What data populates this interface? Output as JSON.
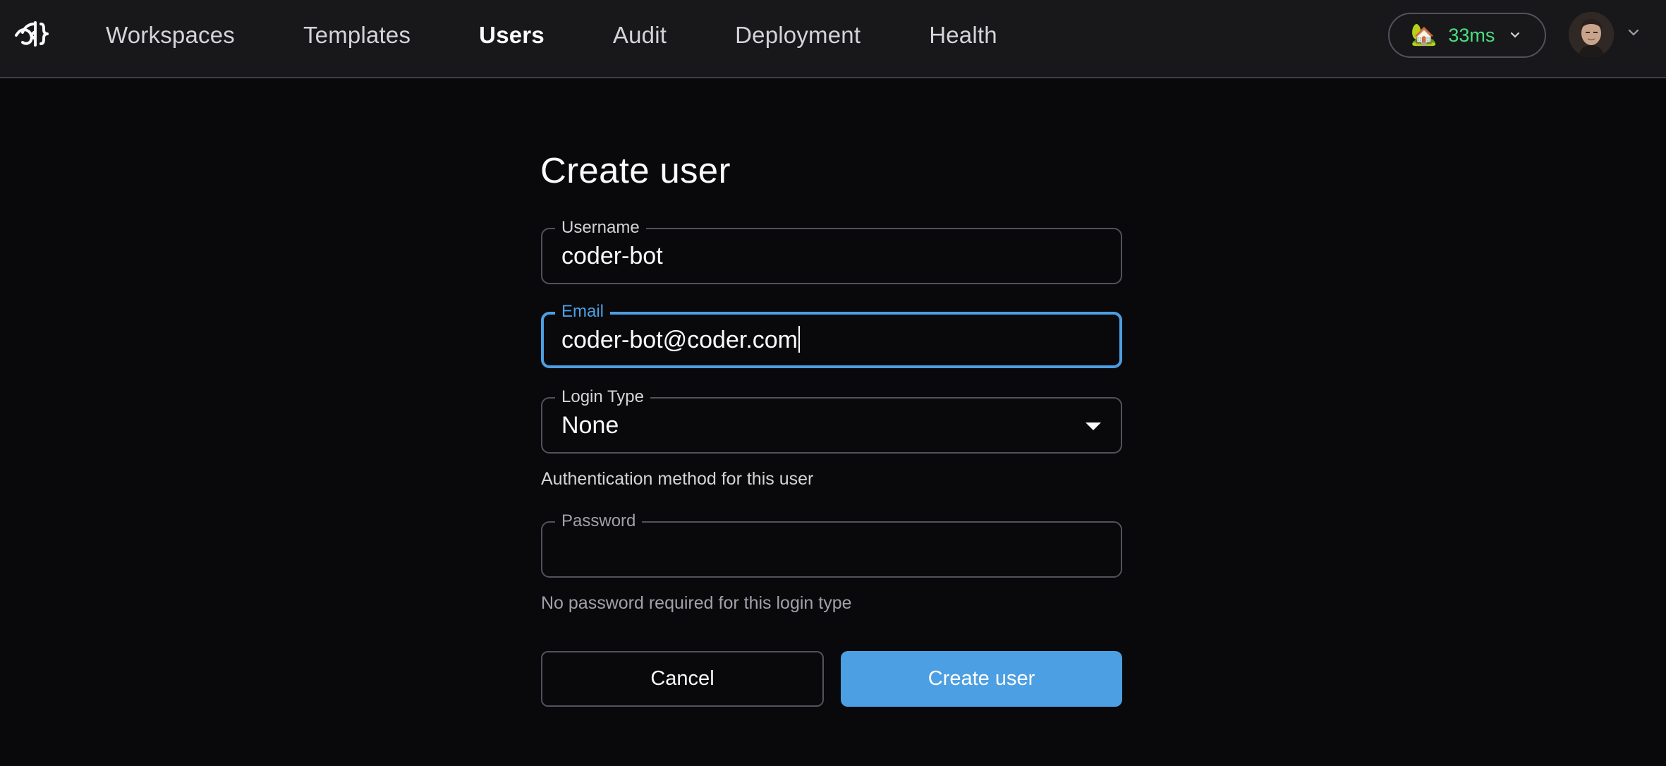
{
  "nav": {
    "items": [
      {
        "label": "Workspaces",
        "active": false
      },
      {
        "label": "Templates",
        "active": false
      },
      {
        "label": "Users",
        "active": true
      },
      {
        "label": "Audit",
        "active": false
      },
      {
        "label": "Deployment",
        "active": false
      },
      {
        "label": "Health",
        "active": false
      }
    ],
    "latency": {
      "icon": "🏡",
      "value": "33ms"
    },
    "colors": {
      "latency_ok": "#4ade80",
      "accent": "#4c9fe2"
    }
  },
  "form": {
    "title": "Create user",
    "username": {
      "label": "Username",
      "value": "coder-bot"
    },
    "email": {
      "label": "Email",
      "value": "coder-bot@coder.com"
    },
    "login_type": {
      "label": "Login Type",
      "value": "None",
      "helper": "Authentication method for this user"
    },
    "password": {
      "label": "Password",
      "value": "",
      "helper": "No password required for this login type"
    },
    "cancel_label": "Cancel",
    "submit_label": "Create user"
  }
}
